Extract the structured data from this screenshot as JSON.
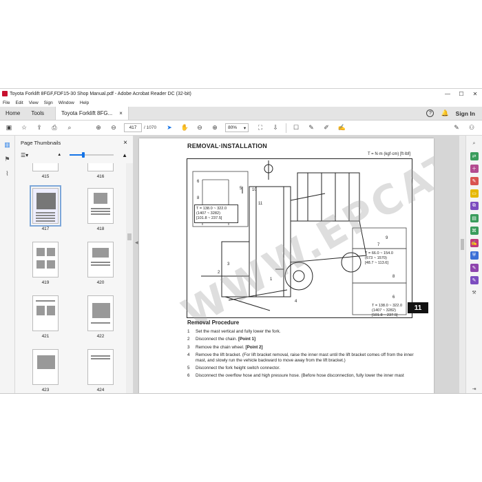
{
  "window": {
    "title": "Toyota Forklift 8FGF,FDF15-30 Shop Manual.pdf - Adobe Acrobat Reader DC (32-bit)",
    "controls": {
      "minimize": "—",
      "maximize": "☐",
      "close": "✕"
    }
  },
  "menu": [
    "File",
    "Edit",
    "View",
    "Sign",
    "Window",
    "Help"
  ],
  "tabs": {
    "home": "Home",
    "tools": "Tools",
    "document": "Toyota Forklift 8FG...",
    "close": "×"
  },
  "header_right": {
    "help_icon": "?",
    "signin": "Sign In"
  },
  "toolbar": {
    "page_current": "417",
    "page_total": "/ 1070",
    "zoom": "80%"
  },
  "thumbnails": {
    "title": "Page Thumbnails",
    "close": "×",
    "pages": [
      {
        "label": "415"
      },
      {
        "label": "416"
      },
      {
        "label": "417",
        "selected": true
      },
      {
        "label": "418"
      },
      {
        "label": "419"
      },
      {
        "label": "420"
      },
      {
        "label": "421"
      },
      {
        "label": "422"
      },
      {
        "label": "423"
      },
      {
        "label": "424"
      }
    ]
  },
  "page": {
    "title": "REMOVAL·INSTALLATION",
    "torque_unit": "T = N·m (kgf·cm) [ft·lbf]",
    "figure": {
      "callout_left": {
        "line1": "T = 138.0 ~ 322.0",
        "line2": "(1407 ~ 3282)",
        "line3": "[101.8 ~ 237.5]"
      },
      "callout_right_top": {
        "line1": "T = 66.0 ~ 154.0",
        "line2": "(673 ~ 1570)",
        "line3": "[48.7 ~ 113.6]"
      },
      "callout_right_bottom": {
        "line1": "T = 138.0 ~ 322.0",
        "line2": "(1407 ~ 3282)",
        "line3": "[101.8 ~ 237.5]"
      },
      "numbers": [
        "6",
        "8",
        "5",
        "10",
        "11",
        "9",
        "7",
        "2",
        "3",
        "1",
        "4",
        "8",
        "6"
      ]
    },
    "section_tab": "11",
    "watermark": "WWW.EPCATALO.COM",
    "procedure": {
      "heading": "Removal Procedure",
      "steps": [
        {
          "num": "1",
          "text": "Set the mast vertical and fully lower the fork.",
          "point": ""
        },
        {
          "num": "2",
          "text": "Disconnect the chain.",
          "point": "[Point 1]"
        },
        {
          "num": "3",
          "text": "Remove the chain wheel.",
          "point": "[Point 2]"
        },
        {
          "num": "4",
          "text": "Remove the lift bracket. (For lift bracket removal, raise the inner mast until the lift bracket comes off from the inner mast, and slowly run the vehicle backward to move away from the lift bracket.)",
          "point": ""
        },
        {
          "num": "5",
          "text": "Disconnect the fork height switch connector.",
          "point": ""
        },
        {
          "num": "6",
          "text": "Disconnect the overflow hose and high pressure hose. (Before hose disconnection, fully lower the inner mast",
          "point": ""
        }
      ]
    }
  },
  "colors": {
    "accent": "#1473e6",
    "acrobat_red": "#c8102e"
  }
}
